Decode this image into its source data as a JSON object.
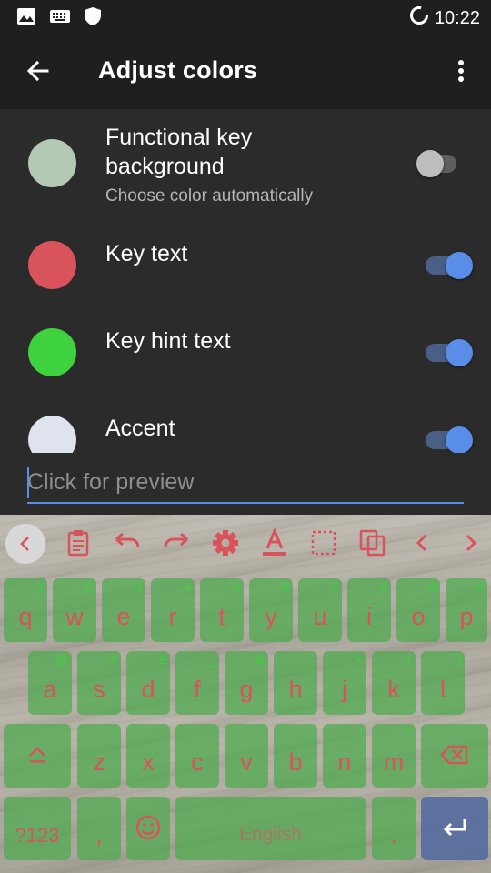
{
  "statusbar": {
    "time": "10:22",
    "icons": [
      "image-icon",
      "keyboard-icon",
      "shield-icon",
      "sync-icon"
    ]
  },
  "appbar": {
    "title": "Adjust colors",
    "icons": [
      "back-arrow-icon",
      "more-vert-icon"
    ]
  },
  "rows": [
    {
      "title_line1": "Functional key",
      "title_line2": "background",
      "subtitle": "Choose color automatically",
      "color": "#b4c9b4",
      "toggle": "off"
    },
    {
      "title": "Key text",
      "color": "#d9535d",
      "toggle": "on"
    },
    {
      "title": "Key hint text",
      "color": "#3ed23e",
      "toggle": "on"
    },
    {
      "title": "Accent",
      "color": "#dfe3ed",
      "toggle": "on"
    }
  ],
  "preview": {
    "placeholder": "Click for preview"
  },
  "toolbar": {
    "icons": [
      "chevron-left-icon",
      "clipboard-icon",
      "undo-icon",
      "redo-icon",
      "settings-icon",
      "text-color-icon",
      "select-all-icon",
      "copy-icon",
      "arrow-left-icon",
      "arrow-right-icon"
    ]
  },
  "keyboard": {
    "row1": [
      {
        "k": "q",
        "h": "1"
      },
      {
        "k": "w",
        "h": "2"
      },
      {
        "k": "e",
        "h": "3"
      },
      {
        "k": "r",
        "h": "4"
      },
      {
        "k": "t",
        "h": "5"
      },
      {
        "k": "y",
        "h": "6"
      },
      {
        "k": "u",
        "h": "7"
      },
      {
        "k": "i",
        "h": "8"
      },
      {
        "k": "o",
        "h": "9"
      },
      {
        "k": "p",
        "h": "0"
      }
    ],
    "row2": [
      {
        "k": "a",
        "h": "@"
      },
      {
        "k": "s",
        "h": "#"
      },
      {
        "k": "d",
        "h": "£"
      },
      {
        "k": "f",
        "h": "_"
      },
      {
        "k": "g",
        "h": "&"
      },
      {
        "k": "h",
        "h": "-"
      },
      {
        "k": "j",
        "h": "+"
      },
      {
        "k": "k",
        "h": "("
      },
      {
        "k": "l",
        "h": ")"
      }
    ],
    "row3": [
      {
        "k": "z",
        "h": "*"
      },
      {
        "k": "x",
        "h": "\""
      },
      {
        "k": "c",
        "h": "'"
      },
      {
        "k": "v",
        "h": ":"
      },
      {
        "k": "b",
        "h": ";"
      },
      {
        "k": "n",
        "h": "!"
      },
      {
        "k": "m",
        "h": "?"
      }
    ],
    "symbols_label": "?123",
    "comma": ",",
    "space_label": "English",
    "period": ".",
    "key_color": "#4caa4c",
    "text_color": "#d9535d",
    "hint_color": "#3ed23e",
    "enter_color": "#5a6f9f"
  }
}
